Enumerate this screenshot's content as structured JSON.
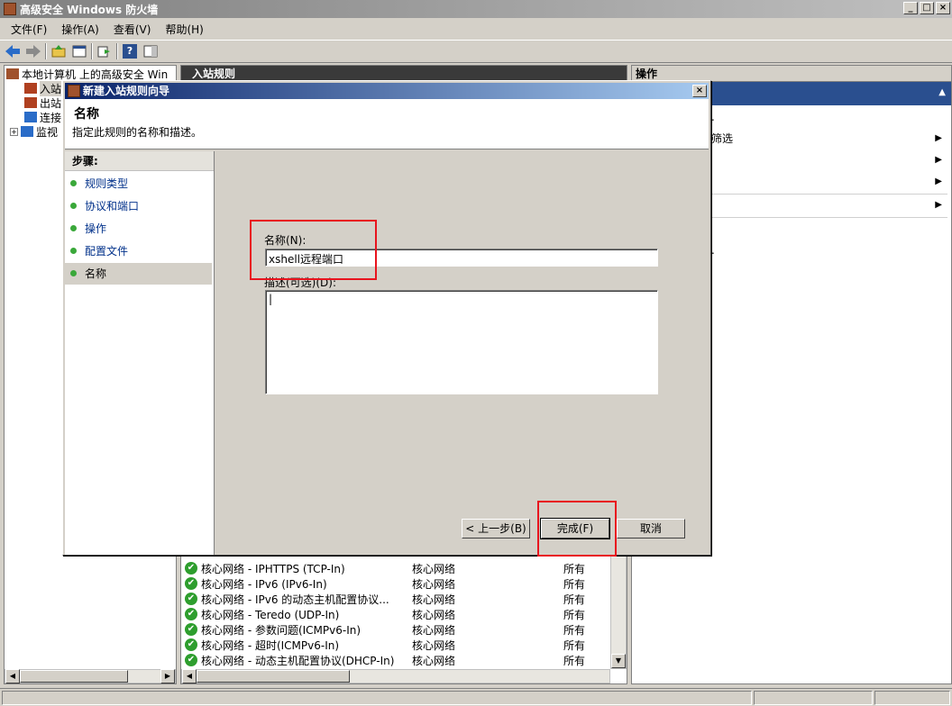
{
  "window": {
    "title": "高级安全 Windows 防火墙",
    "controls": [
      "_",
      "□",
      "×"
    ]
  },
  "menu": [
    "文件(F)",
    "操作(A)",
    "查看(V)",
    "帮助(H)"
  ],
  "toolbar": {
    "icons": [
      "back-icon",
      "forward-icon",
      "up-folder-icon",
      "properties-icon",
      "export-icon",
      "help-icon",
      "show-hide-icon"
    ],
    "help_glyph": "?"
  },
  "tree": {
    "root": "本地计算机 上的高级安全 Win",
    "items": [
      "入站",
      "出站",
      "连接",
      "监视"
    ],
    "expander": "+"
  },
  "center": {
    "header": "入站规则",
    "rows": [
      {
        "name": "核心网络 - IPHTTPS (TCP-In)",
        "group": "核心网络",
        "profile": "所有"
      },
      {
        "name": "核心网络 - IPv6 (IPv6-In)",
        "group": "核心网络",
        "profile": "所有"
      },
      {
        "name": "核心网络 - IPv6 的动态主机配置协议...",
        "group": "核心网络",
        "profile": "所有"
      },
      {
        "name": "核心网络 - Teredo (UDP-In)",
        "group": "核心网络",
        "profile": "所有"
      },
      {
        "name": "核心网络 - 参数问题(ICMPv6-In)",
        "group": "核心网络",
        "profile": "所有"
      },
      {
        "name": "核心网络 - 超时(ICMPv6-In)",
        "group": "核心网络",
        "profile": "所有"
      },
      {
        "name": "核心网络 - 动态主机配置协议(DHCP-In)",
        "group": "核心网络",
        "profile": "所有"
      }
    ],
    "check_glyph": "✔"
  },
  "right": {
    "header": "操作",
    "items": [
      ".",
      "筛选",
      "",
      "",
      "",
      "."
    ],
    "arrow_glyph": "▶",
    "collapse_glyph": "▲"
  },
  "dialog": {
    "title": "新建入站规则向导",
    "close": "×",
    "heading": "名称",
    "subheading": "指定此规则的名称和描述。",
    "steps_header": "步骤:",
    "steps": [
      "规则类型",
      "协议和端口",
      "操作",
      "配置文件",
      "名称"
    ],
    "name_label": "名称(N):",
    "name_value": "xshell远程端口",
    "desc_label": "描述(可选)(D):",
    "desc_value": "|",
    "buttons": {
      "back": "< 上一步(B)",
      "finish": "完成(F)",
      "cancel": "取消"
    }
  },
  "scroll": {
    "left": "◀",
    "right": "▶",
    "down": "▼"
  }
}
